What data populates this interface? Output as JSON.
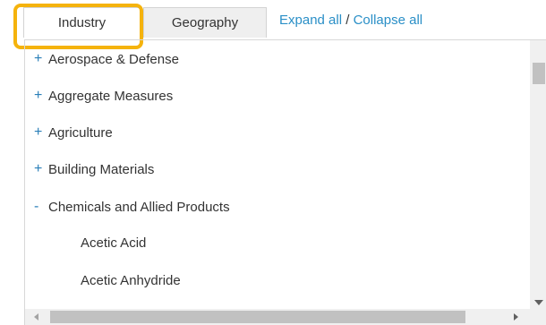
{
  "tabs": [
    {
      "label": "Industry",
      "active": true
    },
    {
      "label": "Geography",
      "active": false
    }
  ],
  "links": {
    "expand_all": "Expand all",
    "separator": " / ",
    "collapse_all": "Collapse all"
  },
  "tree": {
    "items": [
      {
        "sign": "+",
        "label": "Aerospace & Defense",
        "level": 0
      },
      {
        "sign": "+",
        "label": "Aggregate Measures",
        "level": 0
      },
      {
        "sign": "+",
        "label": "Agriculture",
        "level": 0
      },
      {
        "sign": "+",
        "label": "Building Materials",
        "level": 0
      },
      {
        "sign": "-",
        "label": "Chemicals and Allied Products",
        "level": 0
      },
      {
        "sign": "",
        "label": "Acetic Acid",
        "level": 1
      },
      {
        "sign": "",
        "label": "Acetic Anhydride",
        "level": 1
      }
    ]
  },
  "colors": {
    "highlight": "#f5b30d",
    "link": "#2a8fc7",
    "sign": "#2a7fb8"
  }
}
